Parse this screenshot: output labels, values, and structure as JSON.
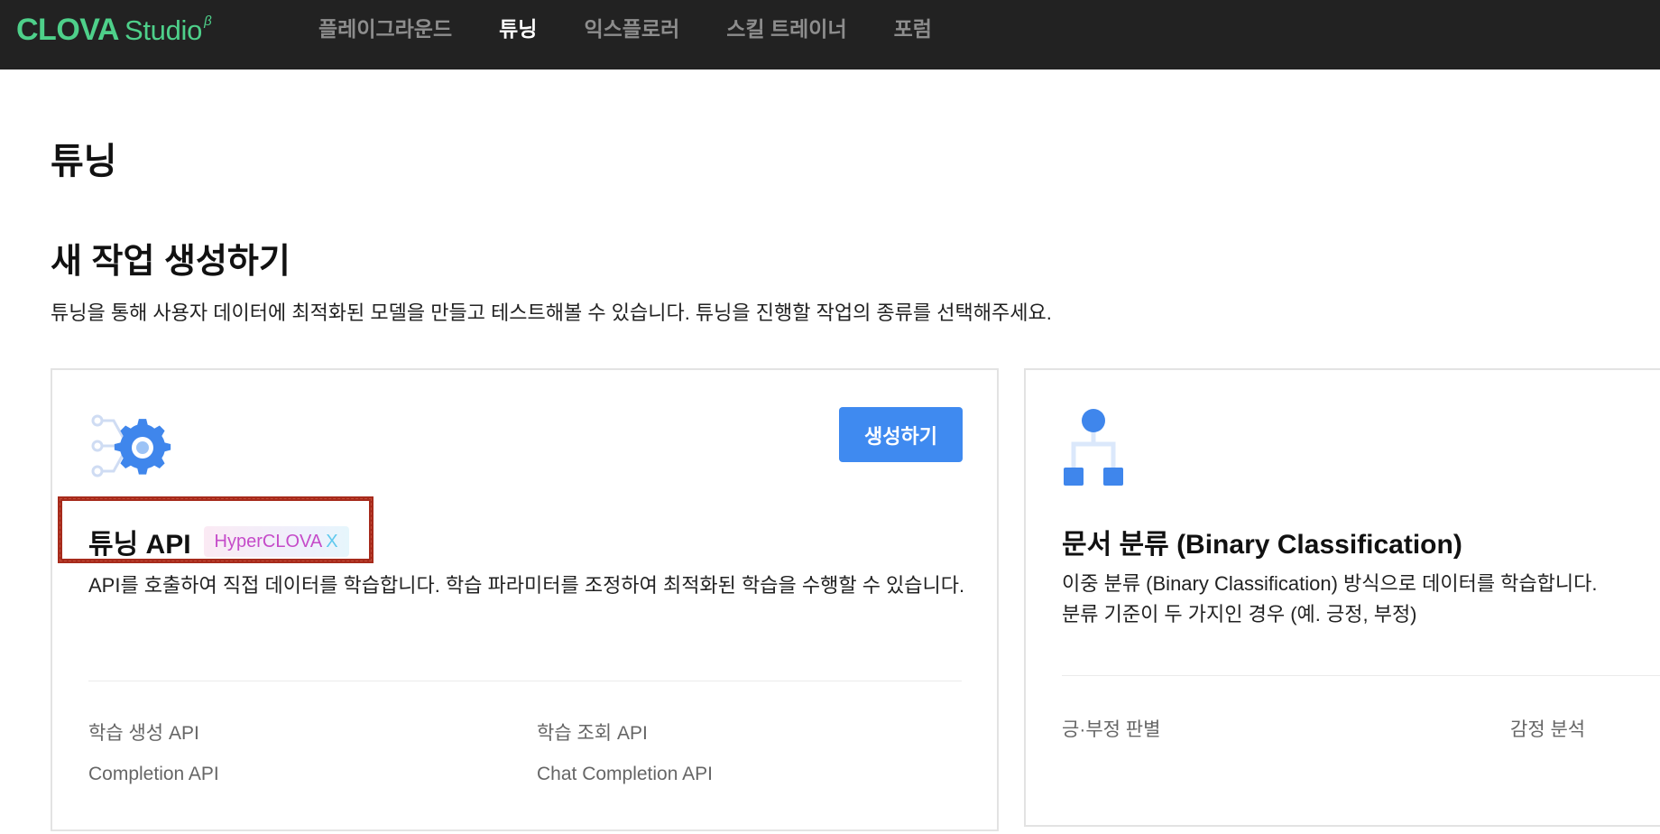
{
  "brand": {
    "name": "CLOVA",
    "product": "Studio",
    "beta": "β"
  },
  "nav": {
    "items": [
      {
        "label": "플레이그라운드",
        "active": false
      },
      {
        "label": "튜닝",
        "active": true
      },
      {
        "label": "익스플로러",
        "active": false
      },
      {
        "label": "스킬 트레이너",
        "active": false
      },
      {
        "label": "포럼",
        "active": false
      }
    ]
  },
  "page": {
    "title": "튜닝",
    "section_title": "새 작업 생성하기",
    "section_desc": "튜닝을 통해 사용자 데이터에 최적화된 모델을 만들고 테스트해볼 수 있습니다. 튜닝을 진행할 작업의 종류를 선택해주세요."
  },
  "cards": [
    {
      "icon": "gear-icon",
      "create_label": "생성하기",
      "title": "튜닝 API",
      "badge": {
        "text": "HyperCLOVA",
        "suffix": "X"
      },
      "desc_lines": [
        "API를 호출하여 직접 데이터를 학습합니다. 학습 파라미터를 조정하여 최적화된 학습을 수행할 수 있습니다."
      ],
      "links": [
        "학습 생성 API",
        "학습 조회 API",
        "Completion API",
        "Chat Completion API"
      ]
    },
    {
      "icon": "hierarchy-icon",
      "title": "문서 분류 (Binary Classification)",
      "desc_lines": [
        "이중 분류 (Binary Classification) 방식으로 데이터를 학습합니다.",
        "분류 기준이 두 가지인 경우 (예. 긍정, 부정)"
      ],
      "links": [
        "긍·부정 판별",
        "감정 분석"
      ]
    }
  ],
  "colors": {
    "topbar": "#222222",
    "brand_green": "#4ed08a",
    "primary_button": "#3f8af0",
    "highlight_border": "#a62a1b"
  }
}
